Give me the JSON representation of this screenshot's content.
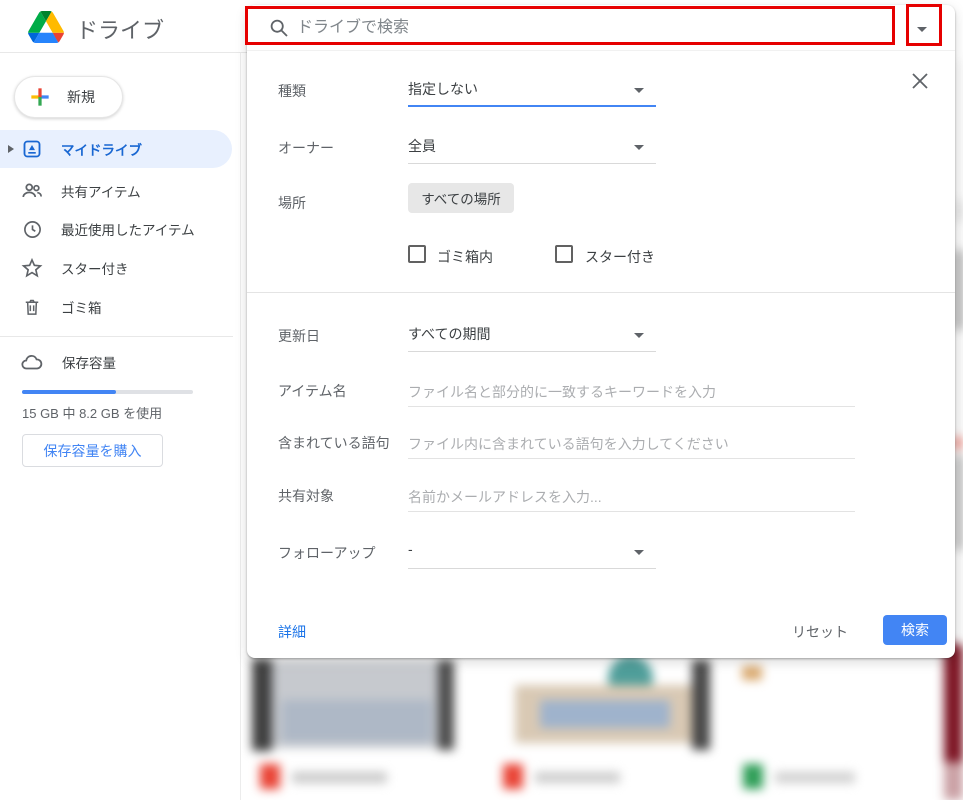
{
  "header": {
    "app_title": "ドライブ",
    "search": {
      "placeholder": "ドライブで検索"
    }
  },
  "sidebar": {
    "new_button_label": "新規",
    "items": [
      {
        "label": "マイドライブ",
        "selected": true
      },
      {
        "label": "共有アイテム",
        "selected": false
      },
      {
        "label": "最近使用したアイテム",
        "selected": false
      },
      {
        "label": "スター付き",
        "selected": false
      },
      {
        "label": "ゴミ箱",
        "selected": false
      }
    ],
    "storage": {
      "title": "保存容量",
      "usage_text": "15 GB 中 8.2 GB を使用",
      "used_percent": 55,
      "buy_button_label": "保存容量を購入"
    }
  },
  "search_panel": {
    "type": {
      "label": "種類",
      "value": "指定しない"
    },
    "owner": {
      "label": "オーナー",
      "value": "全員"
    },
    "location": {
      "label": "場所",
      "chip": "すべての場所"
    },
    "checkboxes": {
      "in_trash": "ゴミ箱内",
      "starred": "スター付き"
    },
    "modified": {
      "label": "更新日",
      "value": "すべての期間"
    },
    "item_name": {
      "label": "アイテム名",
      "placeholder": "ファイル名と部分的に一致するキーワードを入力"
    },
    "contains": {
      "label": "含まれている語句",
      "placeholder": "ファイル内に含まれている語句を入力してください"
    },
    "shared_with": {
      "label": "共有対象",
      "placeholder": "名前かメールアドレスを入力..."
    },
    "follow_up": {
      "label": "フォローアップ",
      "value": "-"
    },
    "footer": {
      "advanced_link": "詳細",
      "reset_label": "リセット",
      "search_button": "検索"
    }
  },
  "colors": {
    "accent_blue": "#4285f4",
    "link_blue": "#1a73e8",
    "selected_item_bg": "#e8f0fe",
    "selected_item_text": "#1967d2",
    "annotation_red": "#e60000"
  }
}
